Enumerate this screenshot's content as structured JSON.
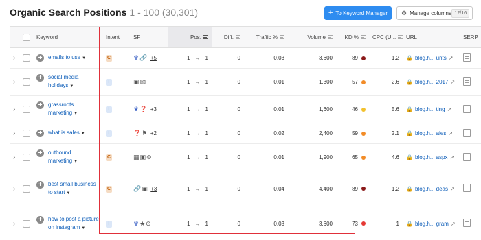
{
  "header": {
    "title": "Organic Search Positions",
    "range": "1 - 100 (30,301)",
    "keyword_manager_label": "To Keyword Manager",
    "manage_columns_label": "Manage columns",
    "columns_count": "12/16"
  },
  "columns": {
    "keyword": "Keyword",
    "intent": "Intent",
    "sf": "SF",
    "pos": "Pos.",
    "diff": "Diff.",
    "traffic": "Traffic %",
    "volume": "Volume",
    "kd": "KD %",
    "cpc": "CPC (U...",
    "url": "URL",
    "serp": "SERP"
  },
  "colors": {
    "intent_commercial": "#f5dcc4",
    "intent_commercial_text": "#c05a00",
    "intent_informational": "#dbe7f8",
    "intent_informational_text": "#2b6cc4",
    "kd_very_hard": "#8b1a1a",
    "kd_difficult": "#f28c28",
    "kd_possible": "#f2c12e",
    "kd_hard": "#e53935",
    "highlight_border": "#e0303a",
    "accent_button": "#2e8cf0"
  },
  "rows": [
    {
      "keyword": "emails to use",
      "intent": "C",
      "sf_icons": [
        "crown-icon",
        "link-icon"
      ],
      "sf_more": "+5",
      "pos_from": "1",
      "pos_to": "1",
      "diff": "0",
      "traffic": "0.03",
      "volume": "3,600",
      "kd": "89",
      "kd_level": "very_hard",
      "cpc": "1.2",
      "url": "blog.h... unts"
    },
    {
      "keyword": "social media holidays",
      "intent": "I",
      "sf_icons": [
        "reviews-icon",
        "image-icon"
      ],
      "sf_more": "",
      "pos_from": "1",
      "pos_to": "1",
      "diff": "0",
      "traffic": "0.01",
      "volume": "1,300",
      "kd": "57",
      "kd_level": "difficult",
      "cpc": "2.6",
      "url": "blog.h... 2017"
    },
    {
      "keyword": "grassroots marketing",
      "intent": "I",
      "sf_icons": [
        "crown-icon",
        "faq-icon"
      ],
      "sf_more": "+3",
      "pos_from": "1",
      "pos_to": "1",
      "diff": "0",
      "traffic": "0.01",
      "volume": "1,600",
      "kd": "46",
      "kd_level": "possible",
      "cpc": "5.6",
      "url": "blog.h... ting"
    },
    {
      "keyword": "what is sales",
      "intent": "I",
      "sf_icons": [
        "faq-icon",
        "flag-icon"
      ],
      "sf_more": "+2",
      "pos_from": "1",
      "pos_to": "1",
      "diff": "0",
      "traffic": "0.02",
      "volume": "2,400",
      "kd": "59",
      "kd_level": "difficult",
      "cpc": "2.1",
      "url": "blog.h... ales"
    },
    {
      "keyword": "outbound marketing",
      "intent": "C",
      "sf_icons": [
        "image-pack-icon",
        "reviews-icon",
        "video-icon"
      ],
      "sf_more": "",
      "pos_from": "1",
      "pos_to": "1",
      "diff": "0",
      "traffic": "0.01",
      "volume": "1,900",
      "kd": "65",
      "kd_level": "difficult",
      "cpc": "4.6",
      "url": "blog.h... aspx"
    },
    {
      "keyword": "best small business to start",
      "intent": "C",
      "sf_icons": [
        "link-icon",
        "reviews-icon"
      ],
      "sf_more": "+3",
      "pos_from": "1",
      "pos_to": "1",
      "diff": "0",
      "traffic": "0.04",
      "volume": "4,400",
      "kd": "89",
      "kd_level": "very_hard",
      "cpc": "1.2",
      "url": "blog.h... deas"
    },
    {
      "keyword": "how to post a picture on instagram",
      "intent": "I",
      "sf_icons": [
        "crown-icon",
        "star-icon",
        "video-icon"
      ],
      "sf_more": "",
      "pos_from": "1",
      "pos_to": "1",
      "diff": "0",
      "traffic": "0.03",
      "volume": "3,600",
      "kd": "73",
      "kd_level": "hard",
      "cpc": "1",
      "url": "blog.h... gram"
    }
  ]
}
